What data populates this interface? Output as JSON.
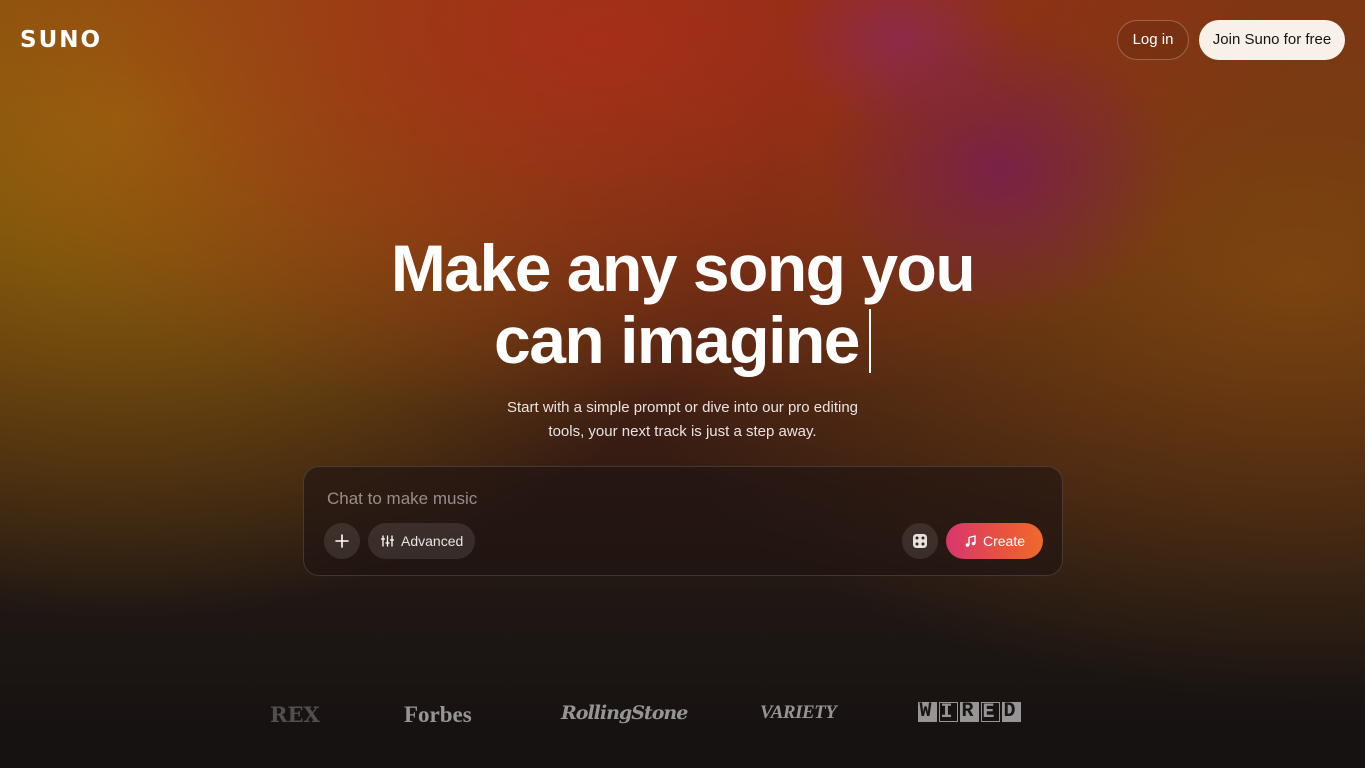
{
  "header": {
    "logo": "SUNO",
    "login_label": "Log in",
    "join_label": "Join Suno for free"
  },
  "hero": {
    "headline_line1": "Make any song you",
    "headline_line2": "can imagine",
    "subtitle": "Start with a simple prompt or dive into our pro editing tools, your next track is just a step away."
  },
  "prompt": {
    "placeholder": "Chat to make music",
    "value": "",
    "advanced_label": "Advanced",
    "create_label": "Create",
    "icons": [
      "plus-icon",
      "sliders-icon",
      "dice-icon",
      "music-note-icon"
    ]
  },
  "press": {
    "logos": [
      "REX",
      "Forbes",
      "RollingStone",
      "VARIETY",
      "WIRED"
    ],
    "wired_letters": [
      "W",
      "I",
      "R",
      "E",
      "D"
    ]
  },
  "colors": {
    "create_gradient_start": "#d8366e",
    "create_gradient_end": "#ee6a2b",
    "join_button_bg": "#f7f1ea"
  }
}
